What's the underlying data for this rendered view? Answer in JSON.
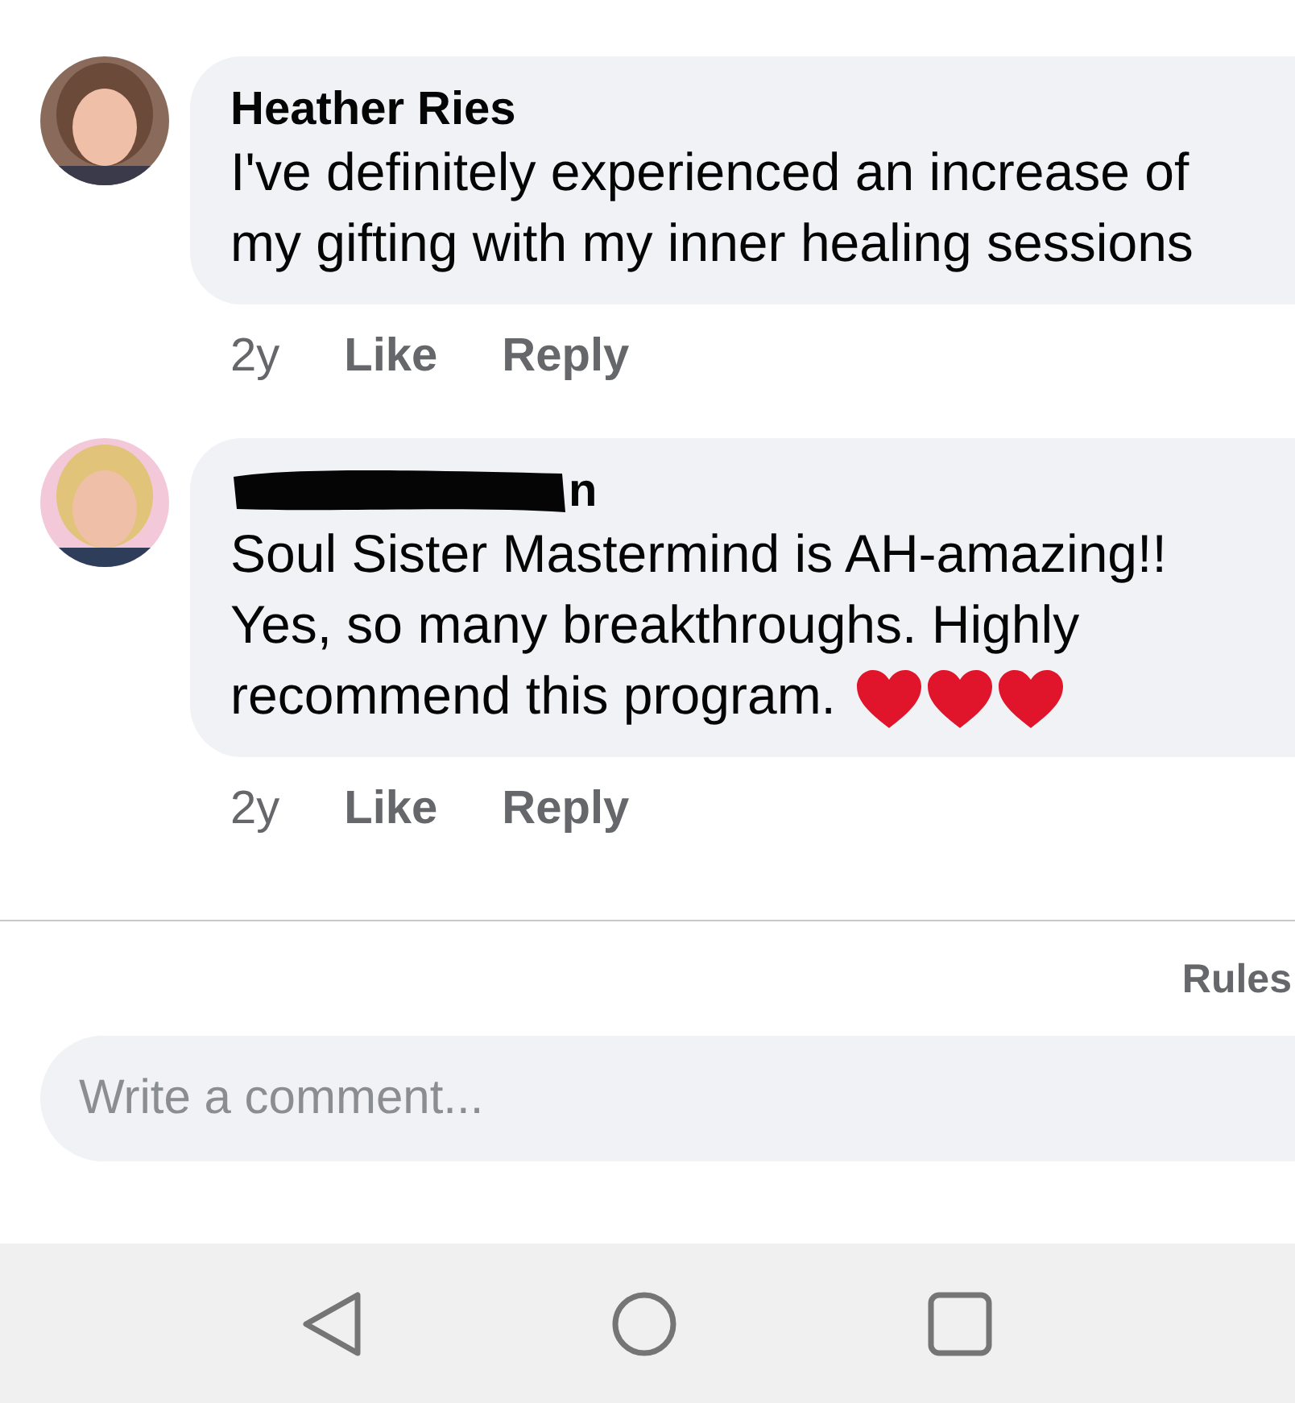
{
  "comments": [
    {
      "name": "Heather Ries",
      "avatar": {
        "kind": "picture"
      },
      "text": "I've definitely experienced an increase of my gifting with my inner healing sessions",
      "age": "2y",
      "actions": [
        "Like",
        "Reply"
      ]
    },
    {
      "name": "n",
      "redacted": true,
      "avatar": {
        "kind": "picture"
      },
      "text": "Soul Sister Mastermind is AH-amazing!! Yes, so many breakthroughs. Highly recommend this program.",
      "icons": [
        {
          "kind": "heart"
        },
        {
          "kind": "heart"
        },
        {
          "kind": "heart"
        }
      ],
      "age": "2y",
      "actions": [
        "Like",
        "Reply"
      ]
    }
  ],
  "rules_link": "Rules",
  "composer": {
    "placeholder": "Write a comment..."
  },
  "nav_buttons": [
    {
      "kind": "back"
    },
    {
      "kind": "home"
    },
    {
      "kind": "recent"
    }
  ]
}
